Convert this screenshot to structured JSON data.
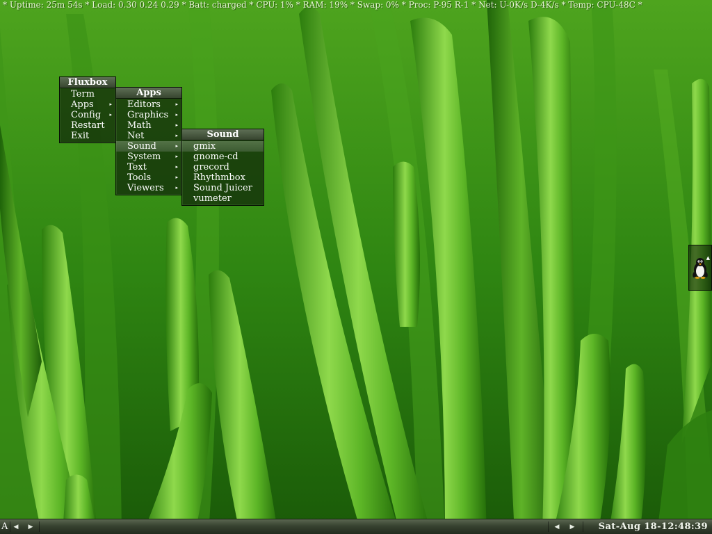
{
  "statusbar": {
    "text": "* Uptime: 25m 54s * Load: 0.30 0.24 0.29 * Batt: charged * CPU: 1% * RAM: 19% * Swap: 0% * Proc: P-95 R-1 * Net: U-0K/s D-4K/s * Temp: CPU-48C *"
  },
  "menus": {
    "root": {
      "title": "Fluxbox",
      "items": [
        {
          "label": "Term",
          "submenu": false
        },
        {
          "label": "Apps",
          "submenu": true
        },
        {
          "label": "Config",
          "submenu": true
        },
        {
          "label": "Restart",
          "submenu": false
        },
        {
          "label": "Exit",
          "submenu": false
        }
      ]
    },
    "apps": {
      "title": "Apps",
      "items": [
        {
          "label": "Editors",
          "submenu": true
        },
        {
          "label": "Graphics",
          "submenu": true
        },
        {
          "label": "Math",
          "submenu": true
        },
        {
          "label": "Net",
          "submenu": true
        },
        {
          "label": "Sound",
          "submenu": true,
          "selected": true
        },
        {
          "label": "System",
          "submenu": true
        },
        {
          "label": "Text",
          "submenu": true
        },
        {
          "label": "Tools",
          "submenu": true
        },
        {
          "label": "Viewers",
          "submenu": true
        }
      ]
    },
    "sound": {
      "title": "Sound",
      "items": [
        {
          "label": "gmix",
          "selected": true
        },
        {
          "label": "gnome-cd"
        },
        {
          "label": "grecord"
        },
        {
          "label": "Rhythmbox"
        },
        {
          "label": "Sound Juicer"
        },
        {
          "label": "vumeter"
        }
      ]
    }
  },
  "slit": {
    "icon": "penguin-icon"
  },
  "toolbar": {
    "workspace": "A",
    "clock": "Sat-Aug 18-12:48:39",
    "icons": [
      "prev-workspace-icon",
      "next-workspace-icon",
      "prev-window-icon",
      "next-window-icon"
    ]
  },
  "colors": {
    "wallpaper_dark": "#1f6a0c",
    "wallpaper_light": "#9be25a",
    "menu_title": "#4a5a42",
    "toolbar": "#36412f"
  }
}
